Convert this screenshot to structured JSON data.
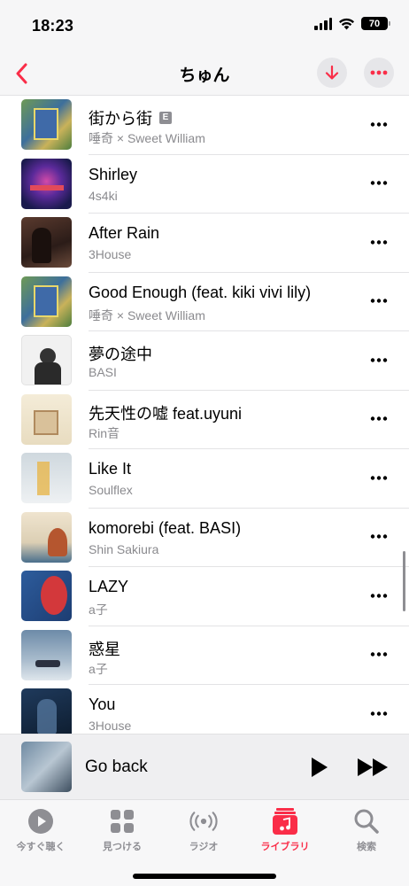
{
  "status": {
    "time": "18:23",
    "battery": "70"
  },
  "nav": {
    "title": "ちゅん"
  },
  "songs": [
    {
      "title": "街から街",
      "artist": "唾奇 × Sweet William",
      "explicit": "E"
    },
    {
      "title": "Shirley",
      "artist": "4s4ki"
    },
    {
      "title": "After Rain",
      "artist": "3House"
    },
    {
      "title": "Good Enough (feat. kiki vivi lily)",
      "artist": "唾奇 × Sweet William"
    },
    {
      "title": "夢の途中",
      "artist": "BASI"
    },
    {
      "title": "先天性の嘘 feat.uyuni",
      "artist": "Rin音"
    },
    {
      "title": "Like It",
      "artist": "Soulflex"
    },
    {
      "title": "komorebi (feat. BASI)",
      "artist": "Shin Sakiura"
    },
    {
      "title": "LAZY",
      "artist": "a子"
    },
    {
      "title": "惑星",
      "artist": "a子"
    },
    {
      "title": "You",
      "artist": "3House"
    }
  ],
  "now_playing": {
    "title": "Go back"
  },
  "tabs": [
    {
      "label": "今すぐ聴く",
      "icon": "play-circle-icon"
    },
    {
      "label": "見つける",
      "icon": "grid-icon"
    },
    {
      "label": "ラジオ",
      "icon": "radio-icon"
    },
    {
      "label": "ライブラリ",
      "icon": "library-music-icon",
      "active": true
    },
    {
      "label": "検索",
      "icon": "search-icon"
    }
  ],
  "colors": {
    "accent": "#fa2d48",
    "secondary_text": "#8a8a8e"
  }
}
